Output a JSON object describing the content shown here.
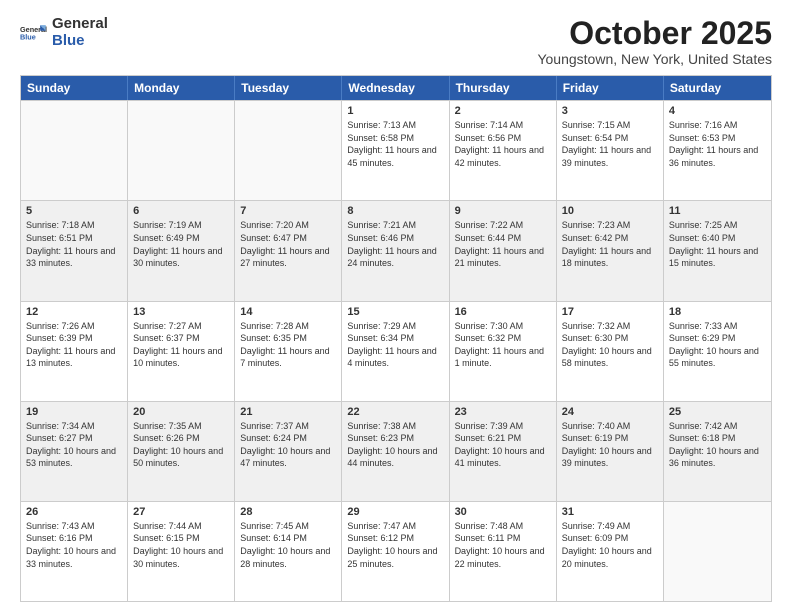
{
  "header": {
    "logo_line1": "General",
    "logo_line2": "Blue",
    "month": "October 2025",
    "location": "Youngstown, New York, United States"
  },
  "days_of_week": [
    "Sunday",
    "Monday",
    "Tuesday",
    "Wednesday",
    "Thursday",
    "Friday",
    "Saturday"
  ],
  "weeks": [
    [
      {
        "day": "",
        "info": ""
      },
      {
        "day": "",
        "info": ""
      },
      {
        "day": "",
        "info": ""
      },
      {
        "day": "1",
        "info": "Sunrise: 7:13 AM\nSunset: 6:58 PM\nDaylight: 11 hours and 45 minutes."
      },
      {
        "day": "2",
        "info": "Sunrise: 7:14 AM\nSunset: 6:56 PM\nDaylight: 11 hours and 42 minutes."
      },
      {
        "day": "3",
        "info": "Sunrise: 7:15 AM\nSunset: 6:54 PM\nDaylight: 11 hours and 39 minutes."
      },
      {
        "day": "4",
        "info": "Sunrise: 7:16 AM\nSunset: 6:53 PM\nDaylight: 11 hours and 36 minutes."
      }
    ],
    [
      {
        "day": "5",
        "info": "Sunrise: 7:18 AM\nSunset: 6:51 PM\nDaylight: 11 hours and 33 minutes."
      },
      {
        "day": "6",
        "info": "Sunrise: 7:19 AM\nSunset: 6:49 PM\nDaylight: 11 hours and 30 minutes."
      },
      {
        "day": "7",
        "info": "Sunrise: 7:20 AM\nSunset: 6:47 PM\nDaylight: 11 hours and 27 minutes."
      },
      {
        "day": "8",
        "info": "Sunrise: 7:21 AM\nSunset: 6:46 PM\nDaylight: 11 hours and 24 minutes."
      },
      {
        "day": "9",
        "info": "Sunrise: 7:22 AM\nSunset: 6:44 PM\nDaylight: 11 hours and 21 minutes."
      },
      {
        "day": "10",
        "info": "Sunrise: 7:23 AM\nSunset: 6:42 PM\nDaylight: 11 hours and 18 minutes."
      },
      {
        "day": "11",
        "info": "Sunrise: 7:25 AM\nSunset: 6:40 PM\nDaylight: 11 hours and 15 minutes."
      }
    ],
    [
      {
        "day": "12",
        "info": "Sunrise: 7:26 AM\nSunset: 6:39 PM\nDaylight: 11 hours and 13 minutes."
      },
      {
        "day": "13",
        "info": "Sunrise: 7:27 AM\nSunset: 6:37 PM\nDaylight: 11 hours and 10 minutes."
      },
      {
        "day": "14",
        "info": "Sunrise: 7:28 AM\nSunset: 6:35 PM\nDaylight: 11 hours and 7 minutes."
      },
      {
        "day": "15",
        "info": "Sunrise: 7:29 AM\nSunset: 6:34 PM\nDaylight: 11 hours and 4 minutes."
      },
      {
        "day": "16",
        "info": "Sunrise: 7:30 AM\nSunset: 6:32 PM\nDaylight: 11 hours and 1 minute."
      },
      {
        "day": "17",
        "info": "Sunrise: 7:32 AM\nSunset: 6:30 PM\nDaylight: 10 hours and 58 minutes."
      },
      {
        "day": "18",
        "info": "Sunrise: 7:33 AM\nSunset: 6:29 PM\nDaylight: 10 hours and 55 minutes."
      }
    ],
    [
      {
        "day": "19",
        "info": "Sunrise: 7:34 AM\nSunset: 6:27 PM\nDaylight: 10 hours and 53 minutes."
      },
      {
        "day": "20",
        "info": "Sunrise: 7:35 AM\nSunset: 6:26 PM\nDaylight: 10 hours and 50 minutes."
      },
      {
        "day": "21",
        "info": "Sunrise: 7:37 AM\nSunset: 6:24 PM\nDaylight: 10 hours and 47 minutes."
      },
      {
        "day": "22",
        "info": "Sunrise: 7:38 AM\nSunset: 6:23 PM\nDaylight: 10 hours and 44 minutes."
      },
      {
        "day": "23",
        "info": "Sunrise: 7:39 AM\nSunset: 6:21 PM\nDaylight: 10 hours and 41 minutes."
      },
      {
        "day": "24",
        "info": "Sunrise: 7:40 AM\nSunset: 6:19 PM\nDaylight: 10 hours and 39 minutes."
      },
      {
        "day": "25",
        "info": "Sunrise: 7:42 AM\nSunset: 6:18 PM\nDaylight: 10 hours and 36 minutes."
      }
    ],
    [
      {
        "day": "26",
        "info": "Sunrise: 7:43 AM\nSunset: 6:16 PM\nDaylight: 10 hours and 33 minutes."
      },
      {
        "day": "27",
        "info": "Sunrise: 7:44 AM\nSunset: 6:15 PM\nDaylight: 10 hours and 30 minutes."
      },
      {
        "day": "28",
        "info": "Sunrise: 7:45 AM\nSunset: 6:14 PM\nDaylight: 10 hours and 28 minutes."
      },
      {
        "day": "29",
        "info": "Sunrise: 7:47 AM\nSunset: 6:12 PM\nDaylight: 10 hours and 25 minutes."
      },
      {
        "day": "30",
        "info": "Sunrise: 7:48 AM\nSunset: 6:11 PM\nDaylight: 10 hours and 22 minutes."
      },
      {
        "day": "31",
        "info": "Sunrise: 7:49 AM\nSunset: 6:09 PM\nDaylight: 10 hours and 20 minutes."
      },
      {
        "day": "",
        "info": ""
      }
    ]
  ]
}
